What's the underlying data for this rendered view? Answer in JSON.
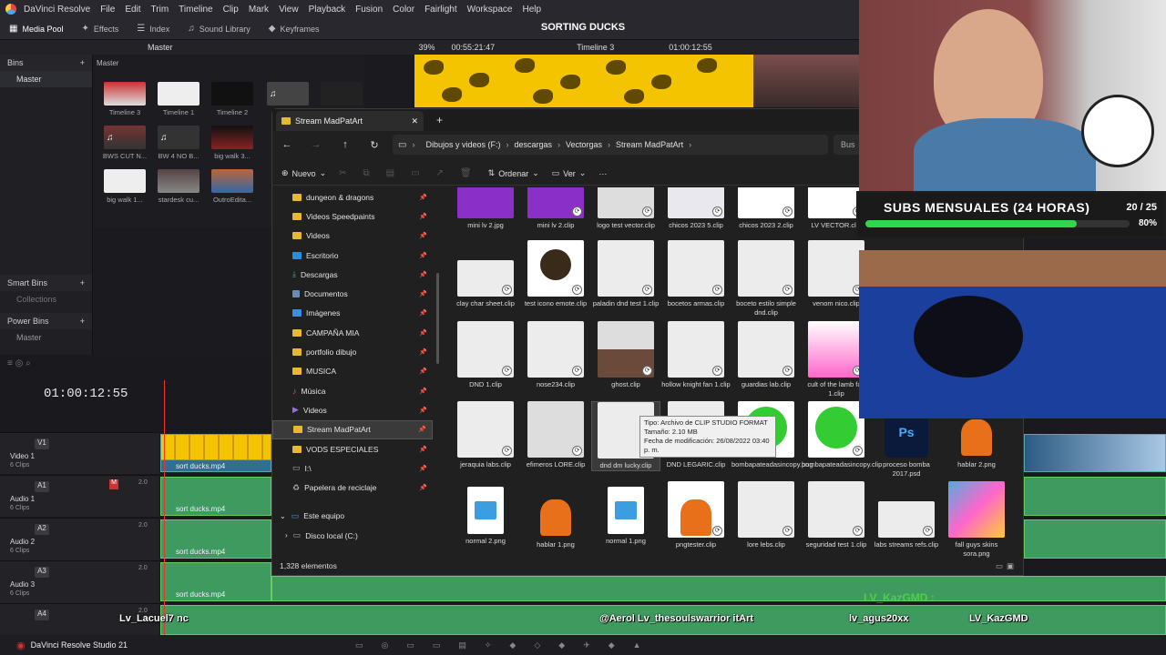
{
  "menubar": {
    "app_name": "DaVinci Resolve",
    "items": [
      "File",
      "Edit",
      "Trim",
      "Timeline",
      "Clip",
      "Mark",
      "View",
      "Playback",
      "Fusion",
      "Color",
      "Fairlight",
      "Workspace",
      "Help"
    ]
  },
  "toolbar": {
    "media_pool": "Media Pool",
    "effects": "Effects",
    "index": "Index",
    "sound_library": "Sound Library",
    "keyframes": "Keyframes"
  },
  "project_title": "SORTING DUCKS",
  "viewer_bar": {
    "bin_label": "Master",
    "zoom": "39%",
    "source_tc": "00:55:21:47",
    "timeline_name": "Timeline 3",
    "timeline_tc": "01:00:12:55"
  },
  "bins": {
    "header": "Bins",
    "master": "Master",
    "smart_bins": "Smart Bins",
    "collections": "Collections",
    "power_bins": "Power Bins",
    "power_master": "Master"
  },
  "media_pool": {
    "path": "Master",
    "clips": [
      "Timeline 3",
      "Timeline 1",
      "Timeline 2",
      "BWS CUT N...",
      "BW 4 NO B...",
      "big walk 3...",
      "big walk 1...",
      "stardesk cu...",
      "OutroEdita..."
    ]
  },
  "timeline": {
    "timecode": "01:00:12:55",
    "tracks": [
      {
        "tag": "V1",
        "name": "Video 1",
        "clips": "6 Clips",
        "clip_label": "sort ducks.mp4"
      },
      {
        "tag": "A1",
        "name": "Audio 1",
        "clips": "6 Clips",
        "clip_label": "sort ducks.mp4",
        "level": "2.0"
      },
      {
        "tag": "A2",
        "name": "Audio 2",
        "clips": "6 Clips",
        "clip_label": "sort ducks.mp4",
        "level": "2.0"
      },
      {
        "tag": "A3",
        "name": "Audio 3",
        "clips": "6 Clips",
        "clip_label": "sort ducks.mp4",
        "level": "2.0"
      },
      {
        "tag": "A4",
        "name": "Audio 4",
        "clips": "",
        "clip_label": "",
        "level": "2.0"
      }
    ]
  },
  "taskbar": {
    "label": "DaVinci Resolve Studio 21"
  },
  "explorer": {
    "tab_title": "Stream MadPatArt",
    "breadcrumbs": [
      "Dibujos y videos (F:)",
      "descargas",
      "Vectorgas",
      "Stream MadPatArt"
    ],
    "search_hint": "Bus",
    "commands": {
      "new": "Nuevo",
      "sort": "Ordenar",
      "view": "Ver"
    },
    "nav_items": [
      {
        "label": "dungeon & dragons",
        "icon": "folder-icon"
      },
      {
        "label": "Videos Speedpaints",
        "icon": "folder-icon"
      },
      {
        "label": "Videos",
        "icon": "folder-icon"
      },
      {
        "label": "Escritorio",
        "icon": "desktop-icon"
      },
      {
        "label": "Descargas",
        "icon": "download-icon"
      },
      {
        "label": "Documentos",
        "icon": "document-icon"
      },
      {
        "label": "Imágenes",
        "icon": "image-icon"
      },
      {
        "label": "CAMPAÑA MIA",
        "icon": "folder-icon"
      },
      {
        "label": "portfolio dibujo",
        "icon": "folder-icon"
      },
      {
        "label": "MUSICA",
        "icon": "folder-icon"
      },
      {
        "label": "Música",
        "icon": "music-icon"
      },
      {
        "label": "Videos",
        "icon": "video-icon"
      },
      {
        "label": "Stream MadPatArt",
        "icon": "folder-icon"
      },
      {
        "label": "VODS ESPECIALES",
        "icon": "folder-icon"
      },
      {
        "label": "I:\\",
        "icon": "drive-icon"
      },
      {
        "label": "Papelera de reciclaje",
        "icon": "recycle-icon"
      }
    ],
    "this_pc": "Este equipo",
    "local_disk": "Disco local (C:)",
    "files": [
      [
        "mini lv 2.jpg",
        "mini lv 2.clip",
        "logo test vector.clip",
        "chicos 2023 5.clip",
        "chicos 2023 2.clip",
        "LV VECTOR.clip"
      ],
      [
        "clay char sheet.clip",
        "test icono emote.clip",
        "paladin dnd test 1.clip",
        "bocetos armas.clip",
        "boceto estilo simple dnd.clip",
        "venom nico.clip"
      ],
      [
        "DND 1.clip",
        "nose234.clip",
        "ghost.clip",
        "hollow knight fan 1.clip",
        "guardias lab.clip",
        "cult of the lamb fan 1.clip"
      ],
      [
        "jeraquia labs.clip",
        "efimeros LORE.clip",
        "dnd dm lucky.clip",
        "DND LEGARIC.clip",
        "bombapateadasincopy.png",
        "bombapateadasincopy.clip",
        "proceso bomba 2017.psd",
        "hablar 2.png"
      ],
      [
        "normal 2.png",
        "hablar 1.png",
        "normal 1.png",
        "pngtester.clip",
        "lore lebs.clip",
        "seguridad test 1.clip",
        "labs streams refs.clip",
        "fall guys skins sora.png"
      ]
    ],
    "tooltip": [
      "Tipo: Archivo de CLIP STUDIO FORMAT",
      "Tamaño: 2.10 MB",
      "Fecha de modificación: 26/08/2022 03:40 p. m."
    ],
    "status": "1,328 elementos"
  },
  "overlay": {
    "subs_title": "SUBS MENSUALES (24 HORAS)",
    "subs_count": "20 / 25",
    "subs_percent": "80%",
    "subs_progress": 0.8,
    "chat_user": "LV_KazGMD :",
    "ticker": [
      "Lv_Lacuel7 nc",
      "@Aerol Lv_thesoulswarrior itArt",
      "lv_agus20xx",
      "LV_KazGMD"
    ],
    "chat_color": "#4dd04d"
  }
}
